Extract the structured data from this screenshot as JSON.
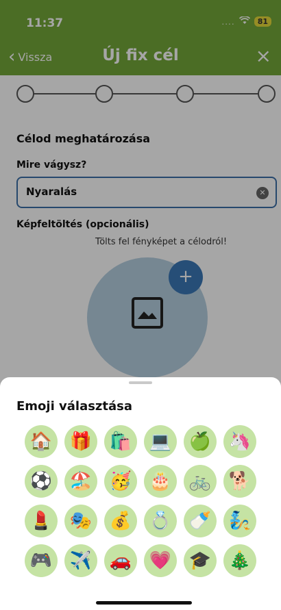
{
  "status_bar": {
    "time": "11:37",
    "signal": "....",
    "wifi_icon": "wifi-icon",
    "battery": "81"
  },
  "nav": {
    "back_label": "Vissza",
    "title": "Új fix cél",
    "close_icon": "close-icon"
  },
  "form": {
    "section_title": "Célod meghatározása",
    "goal_label": "Mire vágysz?",
    "goal_value": "Nyaralás",
    "upload_label": "Képfeltöltés (opcionális)",
    "upload_hint": "Tölts fel fényképet a célodról!"
  },
  "stepper": {
    "steps": 4,
    "current": 1
  },
  "sheet": {
    "title": "Emoji választása",
    "emojis": [
      "🏠",
      "🎁",
      "🛍️",
      "💻",
      "🍏",
      "🦄",
      "⚽",
      "🏖️",
      "🥳",
      "🎂",
      "🚲",
      "🐕",
      "💄",
      "🎭",
      "💰",
      "💍",
      "🍼",
      "🧞",
      "🎮",
      "✈️",
      "🚗",
      "💗",
      "🎓",
      "🎄"
    ]
  },
  "colors": {
    "brand_green": "#74a83a",
    "accent_blue": "#3b78b7",
    "emoji_bg": "#c5e3a4"
  }
}
